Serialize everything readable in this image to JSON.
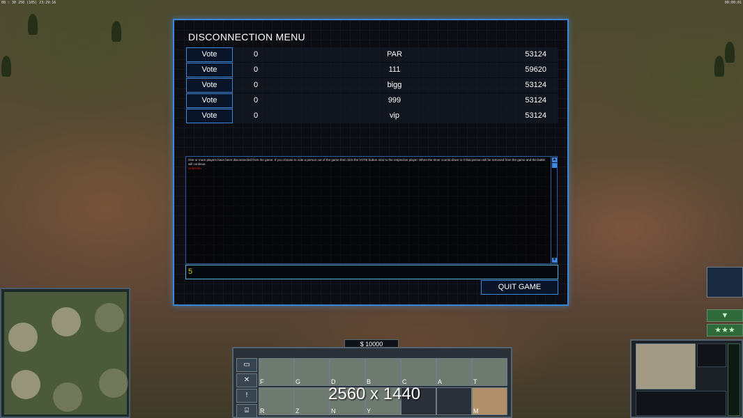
{
  "hud": {
    "top_left": "08 : 30 250 (105) 23:29:16",
    "top_right": "00:00:01"
  },
  "menu": {
    "title": "DISCONNECTION MENU",
    "players": [
      {
        "vote_label": "Vote",
        "votes": "0",
        "name": "PAR",
        "number": "53124"
      },
      {
        "vote_label": "Vote",
        "votes": "0",
        "name": "111",
        "number": "59620"
      },
      {
        "vote_label": "Vote",
        "votes": "0",
        "name": "bigg",
        "number": "53124"
      },
      {
        "vote_label": "Vote",
        "votes": "0",
        "name": "999",
        "number": "53124"
      },
      {
        "vote_label": "Vote",
        "votes": "0",
        "name": "vip",
        "number": "53124"
      }
    ],
    "info_text": "One or more players have been disconnected from the game. If you choose to vote a person out of the game then click the VOTE button next to the respective player. When the timer counts down to 0 that person will be removed from the game and the battle will continue.",
    "info_red": "Unknown",
    "chat_value": "5",
    "quit_label": "QUIT GAME"
  },
  "bottom": {
    "money": "$ 10000",
    "resolution": "2560 x 1440",
    "build_slots": [
      {
        "key": "F"
      },
      {
        "key": "G"
      },
      {
        "key": "D"
      },
      {
        "key": "B"
      },
      {
        "key": "C"
      },
      {
        "key": "A"
      },
      {
        "key": "T"
      },
      {
        "key": "R"
      },
      {
        "key": "Z"
      },
      {
        "key": "N"
      },
      {
        "key": "Y"
      },
      {
        "key": ""
      },
      {
        "key": ""
      },
      {
        "key": "M"
      }
    ]
  },
  "colors": {
    "menu_border": "#3b87d6",
    "chat_text": "#d0d000",
    "warning": "#e02020"
  }
}
